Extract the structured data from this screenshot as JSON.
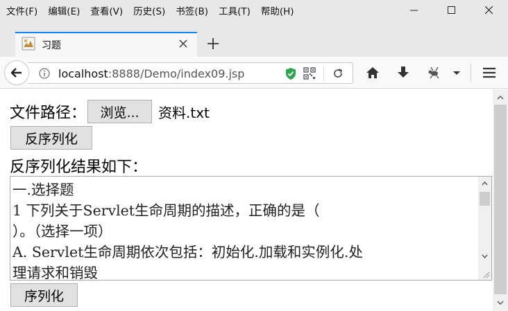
{
  "menu": [
    "文件(F)",
    "编辑(E)",
    "查看(V)",
    "历史(S)",
    "书签(B)",
    "工具(T)",
    "帮助(H)"
  ],
  "tab": {
    "title": "习题"
  },
  "address": {
    "host": "localhost",
    "rest": ":8888/Demo/index09.jsp"
  },
  "page": {
    "file_label": "文件路径：",
    "browse_label": "浏览...",
    "file_name": "资料.txt",
    "deserialize_label": "反序列化",
    "result_heading": "反序列化结果如下：",
    "result_lines": [
      "一.选择题",
      "1  下列关于Servlet生命周期的描述，正确的是（",
      "）。（选择一项）",
      "A. Servlet生命周期依次包括：初始化.加载和实例化.处",
      "理请求和销毁"
    ],
    "serialize_label": "序列化"
  },
  "icons": {
    "back": "arrow-left-icon",
    "info": "info-icon",
    "shield": "shield-icon",
    "qr": "qr-code-icon",
    "reload": "reload-icon",
    "home": "home-icon",
    "download": "download-icon",
    "extension": "extension-icon",
    "menu": "hamburger-menu-icon"
  },
  "colors": {
    "accent": "#0a84ff",
    "chrome": "#e8e8e8"
  }
}
